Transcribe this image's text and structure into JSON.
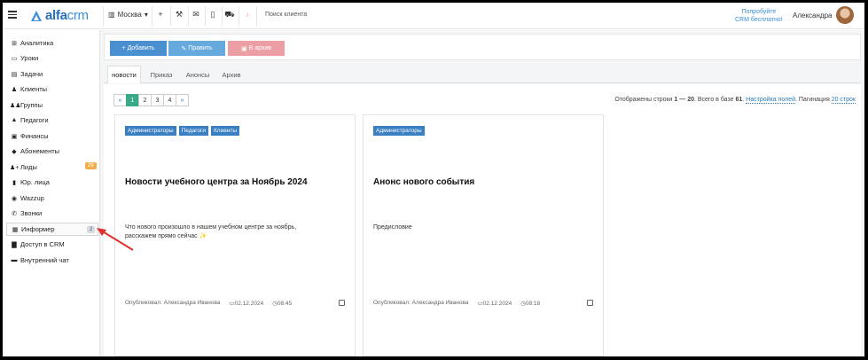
{
  "topbar": {
    "logo_text_a": "alfa",
    "logo_text_b": "crm",
    "city": "Москва",
    "search_label": "Поиск клиента",
    "promo_line1": "Попробуйте",
    "promo_line2": "CRM бесплатно!",
    "user_name": "Александра"
  },
  "sidebar": {
    "items": [
      {
        "label": "Аналитика",
        "icon": "⊞"
      },
      {
        "label": "Уроки",
        "icon": "▭"
      },
      {
        "label": "Задачи",
        "icon": "▤"
      },
      {
        "label": "Клиенты",
        "icon": "♟"
      },
      {
        "label": "Группы",
        "icon": "♟♟"
      },
      {
        "label": "Педагоги",
        "icon": "▲"
      },
      {
        "label": "Финансы",
        "icon": "▣"
      },
      {
        "label": "Абонементы",
        "icon": "◆"
      },
      {
        "label": "Лиды",
        "icon": "♟+",
        "badge": "29"
      },
      {
        "label": "Юр. лица",
        "icon": "▮"
      },
      {
        "label": "Wazzup",
        "icon": "◉"
      },
      {
        "label": "Звонки",
        "icon": "✆"
      },
      {
        "label": "Информер",
        "icon": "▦",
        "badge": "2"
      },
      {
        "label": "Доступ в CRM",
        "icon": "▇"
      },
      {
        "label": "Внутренний чат",
        "icon": "▬"
      }
    ]
  },
  "toolbar": {
    "add_label": "Добавить",
    "edit_label": "Править",
    "archive_label": "В архив"
  },
  "tabs": [
    "новости",
    "Приказ",
    "Анонсы",
    "Архив"
  ],
  "pager": {
    "prev": "«",
    "pages": [
      "1",
      "2",
      "3",
      "4"
    ],
    "next": "»",
    "info_prefix": "Отображены строки ",
    "info_range": "1 — 20",
    "info_mid": ". Всего в базе ",
    "info_total": "61",
    "info_dot": ".",
    "settings_link": "Настройка полей",
    "pagination_label": ". Пагинация",
    "pagination_value": "20 строк"
  },
  "cards": [
    {
      "tags": [
        "Администраторы",
        "Педагоги",
        "Клиенты"
      ],
      "title": "Новости учебного центра за Ноябрь 2024",
      "text": "Что нового произошло в нашем учебном центре за ноябрь, расскажем прямо сейчас ✨",
      "author": "Опубликовал: Александра Иванова",
      "date": "02.12.2024",
      "time": "08:45"
    },
    {
      "tags": [
        "Администраторы"
      ],
      "title": "Анонс нового события",
      "text": "Предисловие",
      "author": "Опубликовал: Александра Иванова",
      "date": "02.12.2024",
      "time": "08:18"
    }
  ],
  "colors": {
    "accent": "#4a8fd0",
    "pager_active": "#3aa98a",
    "archive": "#eb9ea4",
    "tag": "#3a7fc1",
    "arrow": "#e03131"
  }
}
